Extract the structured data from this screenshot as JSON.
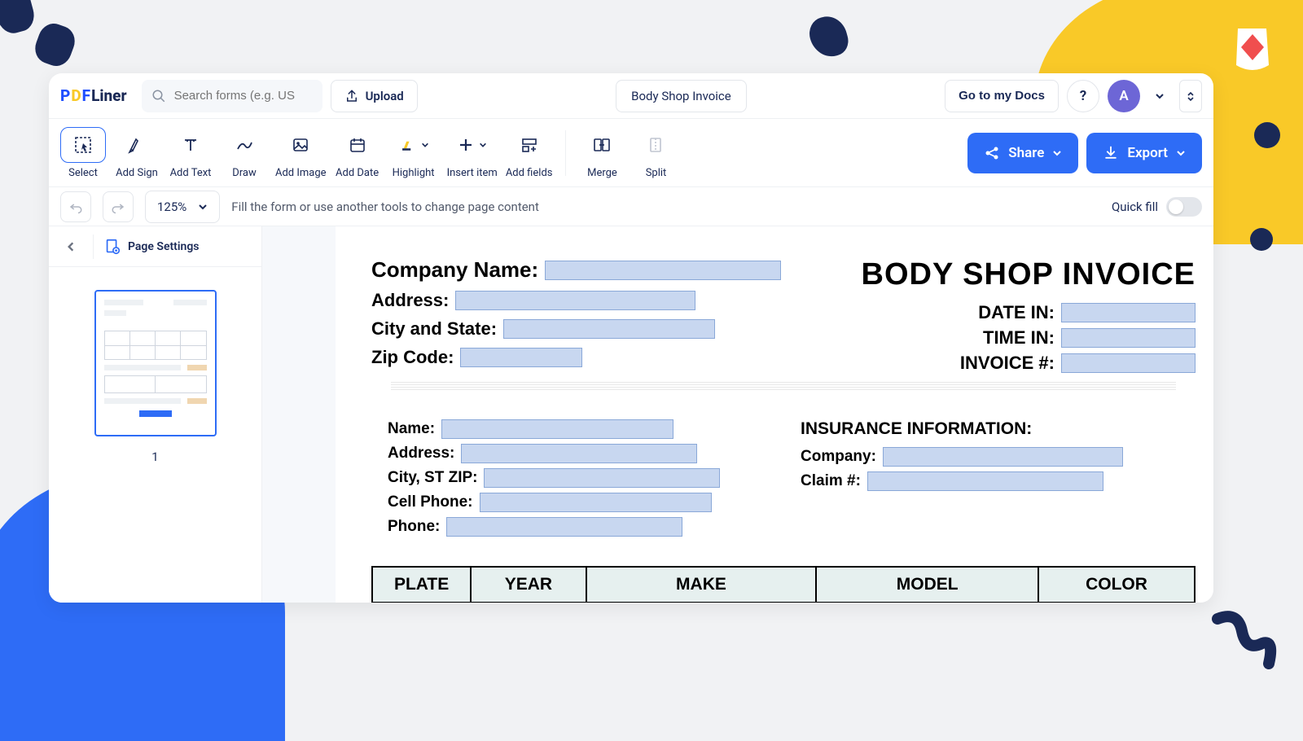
{
  "app": {
    "logo": {
      "pdf": "PDF",
      "liner": "Liner"
    },
    "search_placeholder": "Search forms (e.g. US",
    "upload_label": "Upload",
    "doc_title": "Body Shop Invoice",
    "goto_docs_label": "Go to my Docs",
    "avatar_letter": "A"
  },
  "toolbar": {
    "items": [
      {
        "label": "Select",
        "active": true
      },
      {
        "label": "Add Sign"
      },
      {
        "label": "Add Text"
      },
      {
        "label": "Draw"
      },
      {
        "label": "Add Image"
      },
      {
        "label": "Add Date"
      },
      {
        "label": "Highlight"
      },
      {
        "label": "Insert item"
      },
      {
        "label": "Add fields"
      }
    ],
    "merge_label": "Merge",
    "split_label": "Split",
    "share_label": "Share",
    "export_label": "Export"
  },
  "subbar": {
    "zoom": "125%",
    "hint": "Fill the form or use another tools to change page content",
    "quickfill_label": "Quick fill"
  },
  "sidebar": {
    "page_settings_label": "Page Settings",
    "thumb_number": "1"
  },
  "doc": {
    "title": "BODY SHOP INVOICE",
    "company": {
      "name_label": "Company Name:",
      "address_label": "Address:",
      "city_state_label": "City and State:",
      "zip_label": "Zip Code:"
    },
    "meta": {
      "date_in_label": "DATE IN:",
      "time_in_label": "TIME IN:",
      "invoice_no_label": "INVOICE #:"
    },
    "customer": {
      "name_label": "Name:",
      "address_label": "Address:",
      "city_st_zip_label": "City, ST ZIP:",
      "cell_label": "Cell Phone:",
      "phone_label": "Phone:"
    },
    "insurance": {
      "section_title": "INSURANCE INFORMATION:",
      "company_label": "Company:",
      "claim_label": "Claim #:"
    },
    "vehicle_table": {
      "headers": [
        "PLATE",
        "YEAR",
        "MAKE",
        "MODEL",
        "COLOR"
      ]
    }
  }
}
